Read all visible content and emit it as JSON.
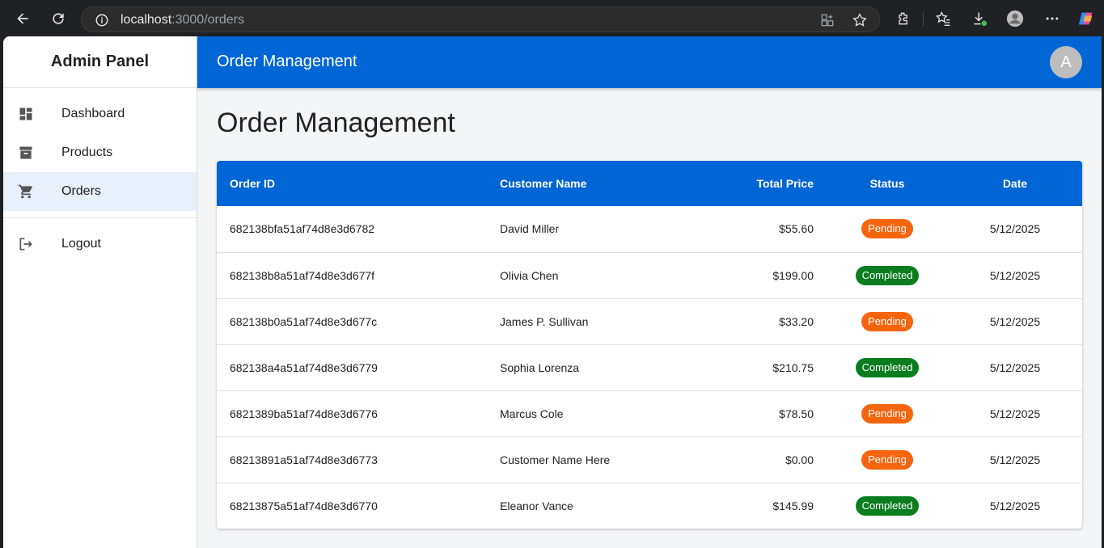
{
  "browser": {
    "url_host": "localhost",
    "url_path": ":3000/orders"
  },
  "sidebar": {
    "title": "Admin Panel",
    "items": [
      {
        "label": "Dashboard",
        "icon": "dashboard-icon"
      },
      {
        "label": "Products",
        "icon": "archive-icon"
      },
      {
        "label": "Orders",
        "icon": "cart-icon",
        "active": true
      }
    ],
    "logout_label": "Logout"
  },
  "appbar": {
    "title": "Order Management",
    "avatar_letter": "A"
  },
  "page": {
    "title": "Order Management"
  },
  "table": {
    "headers": {
      "order_id": "Order ID",
      "customer_name": "Customer Name",
      "total_price": "Total Price",
      "status": "Status",
      "date": "Date"
    },
    "rows": [
      {
        "order_id": "682138bfa51af74d8e3d6782",
        "customer": "David Miller",
        "total": "$55.60",
        "status": "Pending",
        "date": "5/12/2025"
      },
      {
        "order_id": "682138b8a51af74d8e3d677f",
        "customer": "Olivia Chen",
        "total": "$199.00",
        "status": "Completed",
        "date": "5/12/2025"
      },
      {
        "order_id": "682138b0a51af74d8e3d677c",
        "customer": "James P. Sullivan",
        "total": "$33.20",
        "status": "Pending",
        "date": "5/12/2025"
      },
      {
        "order_id": "682138a4a51af74d8e3d6779",
        "customer": "Sophia Lorenza",
        "total": "$210.75",
        "status": "Completed",
        "date": "5/12/2025"
      },
      {
        "order_id": "6821389ba51af74d8e3d6776",
        "customer": "Marcus Cole",
        "total": "$78.50",
        "status": "Pending",
        "date": "5/12/2025"
      },
      {
        "order_id": "68213891a51af74d8e3d6773",
        "customer": "Customer Name Here",
        "total": "$0.00",
        "status": "Pending",
        "date": "5/12/2025"
      },
      {
        "order_id": "68213875a51af74d8e3d6770",
        "customer": "Eleanor Vance",
        "total": "$145.99",
        "status": "Completed",
        "date": "5/12/2025"
      }
    ]
  },
  "colors": {
    "primary": "#0066d6",
    "pending": "#f5650d",
    "completed": "#0b7d1f"
  }
}
